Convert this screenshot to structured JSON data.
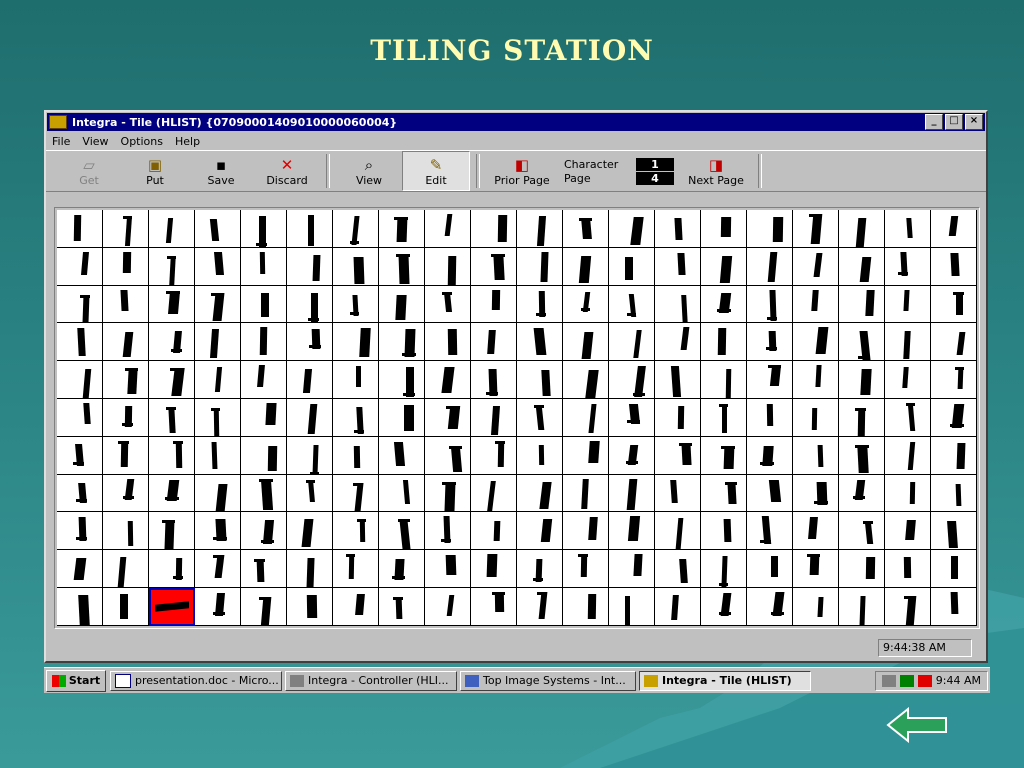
{
  "slide": {
    "title": "TILING STATION"
  },
  "window": {
    "title": "Integra - Tile (HLIST) {07090001409010000060004}",
    "controls": {
      "minimize": "_",
      "maximize": "□",
      "close": "×"
    }
  },
  "menu": [
    "File",
    "View",
    "Options",
    "Help"
  ],
  "toolbar": {
    "get": "Get",
    "put": "Put",
    "save": "Save",
    "discard": "Discard",
    "view": "View",
    "edit": "Edit",
    "prior_page": "Prior Page",
    "character_label": "Character",
    "character_value": "1",
    "page_label": "Page",
    "page_value": "4",
    "next_page": "Next Page"
  },
  "tiles": {
    "rows": 11,
    "columns": 20,
    "selected_row": 10,
    "selected_col": 2
  },
  "status": {
    "time": "9:44:38 AM"
  },
  "taskbar": {
    "start": "Start",
    "items": [
      "presentation.doc - Micro...",
      "Integra - Controller (HLI...",
      "Top Image Systems - Int...",
      "Integra - Tile (HLIST)"
    ],
    "clock": "9:44 AM"
  },
  "colors": {
    "background": "#2a8282",
    "title": "#fffbb0",
    "selected_tile": "#ff0000",
    "titlebar": "#000080"
  }
}
